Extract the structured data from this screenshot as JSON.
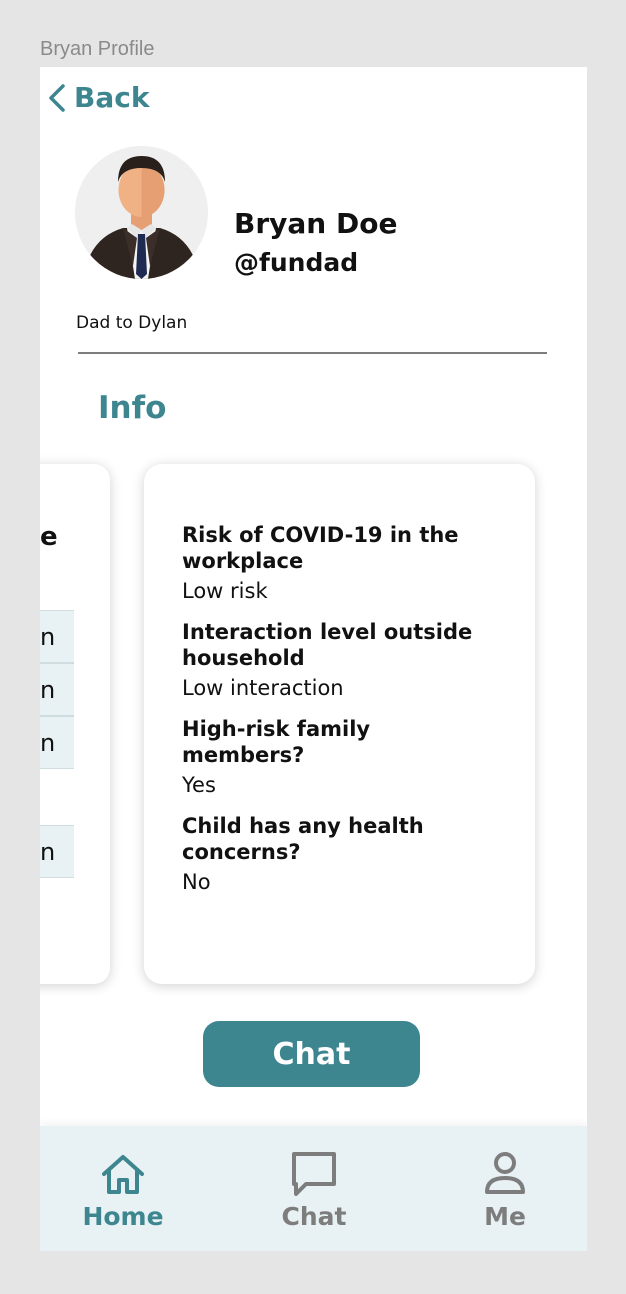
{
  "frame": {
    "label": "Bryan Profile"
  },
  "header": {
    "back_label": "Back"
  },
  "profile": {
    "name": "Bryan Doe",
    "handle": "@fundad",
    "bio": "Dad to Dylan"
  },
  "info": {
    "title": "Info",
    "left_card": {
      "title_fragment": "e",
      "rows": [
        "n",
        "n",
        "n",
        "n"
      ]
    },
    "questions": [
      {
        "question": "Risk of COVID-19 in the workplace",
        "answer": "Low risk"
      },
      {
        "question": "Interaction level outside household",
        "answer": "Low interaction"
      },
      {
        "question": "High-risk family members?",
        "answer": "Yes"
      },
      {
        "question": "Child has any health concerns?",
        "answer": "No"
      }
    ]
  },
  "actions": {
    "chat_label": "Chat"
  },
  "nav": {
    "items": [
      {
        "label": "Home",
        "icon": "home-icon",
        "active": true
      },
      {
        "label": "Chat",
        "icon": "chat-icon",
        "active": false
      },
      {
        "label": "Me",
        "icon": "person-icon",
        "active": false
      }
    ]
  },
  "colors": {
    "accent": "#3d8690",
    "nav_bg": "#e8f1f3",
    "inactive": "#7d7d7d"
  }
}
